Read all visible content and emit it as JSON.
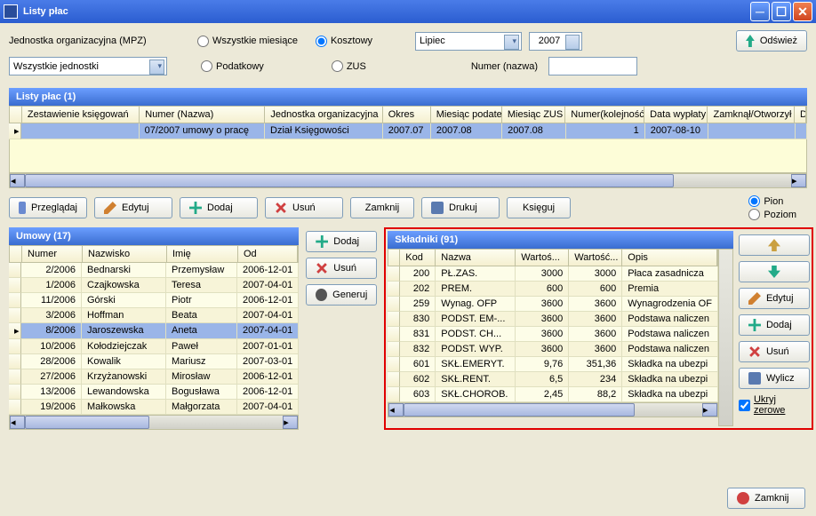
{
  "window": {
    "title": "Listy płac"
  },
  "filter": {
    "unit_label": "Jednostka organizacyjna (MPZ)",
    "unit_value": "Wszystkie jednostki",
    "r_all": "Wszystkie miesiące",
    "r_kosz": "Kosztowy",
    "r_pod": "Podatkowy",
    "r_zus": "ZUS",
    "month": "Lipiec",
    "year": "2007",
    "num_label": "Numer (nazwa)",
    "refresh": "Odśwież"
  },
  "listy": {
    "header": "Listy płac (1)",
    "cols": {
      "c1": "Zestawienie księgowań",
      "c2": "Numer (Nazwa)",
      "c3": "Jednostka organizacyjna",
      "c4": "Okres",
      "c5": "Miesiąc podatek",
      "c6": "Miesiąc ZUS",
      "c7": "Numer(kolejność)",
      "c8": "Data wypłaty",
      "c9": "Zamknął/Otworzył",
      "c10": "Data z"
    },
    "row": {
      "c2": "07/2007 umowy o pracę",
      "c3": "Dział Księgowości",
      "c4": "2007.07",
      "c5": "2007.08",
      "c6": "2007.08",
      "c7": "1",
      "c8": "2007-08-10"
    }
  },
  "toolbar": {
    "view": "Przeglądaj",
    "edit": "Edytuj",
    "add": "Dodaj",
    "del": "Usuń",
    "close": "Zamknij",
    "print": "Drukuj",
    "book": "Księguj",
    "pion": "Pion",
    "poziom": "Poziom"
  },
  "umowy": {
    "header": "Umowy (17)",
    "cols": {
      "c1": "Numer",
      "c2": "Nazwisko",
      "c3": "Imię",
      "c4": "Od"
    },
    "rows": [
      {
        "n": "2/2006",
        "s": "Bednarski",
        "i": "Przemysław",
        "o": "2006-12-01"
      },
      {
        "n": "1/2006",
        "s": "Czajkowska",
        "i": "Teresa",
        "o": "2007-04-01"
      },
      {
        "n": "11/2006",
        "s": "Górski",
        "i": "Piotr",
        "o": "2006-12-01"
      },
      {
        "n": "3/2006",
        "s": "Hoffman",
        "i": "Beata",
        "o": "2007-04-01"
      },
      {
        "n": "8/2006",
        "s": "Jaroszewska",
        "i": "Aneta",
        "o": "2007-04-01"
      },
      {
        "n": "10/2006",
        "s": "Kołodziejczak",
        "i": "Paweł",
        "o": "2007-01-01"
      },
      {
        "n": "28/2006",
        "s": "Kowalik",
        "i": "Mariusz",
        "o": "2007-03-01"
      },
      {
        "n": "27/2006",
        "s": "Krzyżanowski",
        "i": "Mirosław",
        "o": "2006-12-01"
      },
      {
        "n": "13/2006",
        "s": "Lewandowska",
        "i": "Bogusława",
        "o": "2006-12-01"
      },
      {
        "n": "19/2006",
        "s": "Małkowska",
        "i": "Małgorzata",
        "o": "2007-04-01"
      }
    ],
    "btn_add": "Dodaj",
    "btn_del": "Usuń",
    "btn_gen": "Generuj"
  },
  "skladniki": {
    "header": "Składniki (91)",
    "cols": {
      "c1": "Kod",
      "c2": "Nazwa",
      "c3": "Wartoś...",
      "c4": "Wartość...",
      "c5": "Opis"
    },
    "rows": [
      {
        "k": "200",
        "n": "PŁ.ZAS.",
        "w1": "3000",
        "w2": "3000",
        "o": "Płaca zasadnicza"
      },
      {
        "k": "202",
        "n": "PREM.",
        "w1": "600",
        "w2": "600",
        "o": "Premia"
      },
      {
        "k": "259",
        "n": "Wynag. OFP",
        "w1": "3600",
        "w2": "3600",
        "o": "Wynagrodzenia OF"
      },
      {
        "k": "830",
        "n": "PODST. EM-...",
        "w1": "3600",
        "w2": "3600",
        "o": "Podstawa naliczen"
      },
      {
        "k": "831",
        "n": "PODST. CH...",
        "w1": "3600",
        "w2": "3600",
        "o": "Podstawa naliczen"
      },
      {
        "k": "832",
        "n": "PODST. WYP.",
        "w1": "3600",
        "w2": "3600",
        "o": "Podstawa naliczen"
      },
      {
        "k": "601",
        "n": "SKŁ.EMERYT.",
        "w1": "9,76",
        "w2": "351,36",
        "o": "Składka na ubezpi"
      },
      {
        "k": "602",
        "n": "SKŁ.RENT.",
        "w1": "6,5",
        "w2": "234",
        "o": "Składka na ubezpi"
      },
      {
        "k": "603",
        "n": "SKŁ.CHOROB.",
        "w1": "2,45",
        "w2": "88,2",
        "o": "Składka na ubezpi"
      }
    ],
    "btn_edit": "Edytuj",
    "btn_add": "Dodaj",
    "btn_del": "Usuń",
    "btn_calc": "Wylicz",
    "chk_hide": "Ukryj zerowe"
  },
  "footer": {
    "close": "Zamknij"
  }
}
